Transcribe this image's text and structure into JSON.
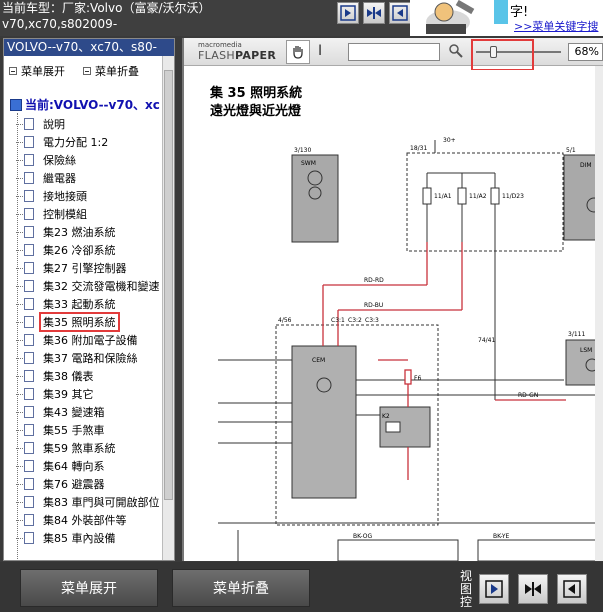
{
  "header": {
    "car_title": "当前车型：厂家:Volvo（富豪/沃尔沃）",
    "car_model": "v70,xc70,s802009-"
  },
  "ad": {
    "text": "字!",
    "link": ">>菜单关键字搜"
  },
  "sidebar": {
    "head": "VOLVO--v70、xc70、s80-",
    "expand_label": "菜单展开",
    "collapse_label": "菜单折叠",
    "root_label": "当前:VOLVO--v70、xc",
    "items": [
      {
        "label": "說明"
      },
      {
        "label": "電力分配 1:2"
      },
      {
        "label": "保險絲"
      },
      {
        "label": "繼電器"
      },
      {
        "label": "接地接頭"
      },
      {
        "label": "控制模組"
      },
      {
        "label": "集23 燃油系統"
      },
      {
        "label": "集26 冷卻系統"
      },
      {
        "label": "集27 引擎控制器"
      },
      {
        "label": "集32 交流發電機和變速"
      },
      {
        "label": "集33 起動系統"
      },
      {
        "label": "集35 照明系統",
        "selected": true
      },
      {
        "label": "集36 附加電子設備"
      },
      {
        "label": "集37 電路和保險絲"
      },
      {
        "label": "集38 儀表"
      },
      {
        "label": "集39 其它"
      },
      {
        "label": "集43 變速箱"
      },
      {
        "label": "集55 手煞車"
      },
      {
        "label": "集59 煞車系統"
      },
      {
        "label": "集64 轉向系"
      },
      {
        "label": "集76 避震器"
      },
      {
        "label": "集83 車門與可開啟部位"
      },
      {
        "label": "集84 外裝部件等"
      },
      {
        "label": "集85 車內設備"
      }
    ]
  },
  "viewer": {
    "logo_small": "macromedia",
    "logo_big_a": "FLASH",
    "logo_big_b": "PAPER",
    "search_value": "",
    "zoom": "68%",
    "zoom_level": 0.18,
    "doc_title": "集 35 照明系統",
    "doc_subtitle": "遠光燈與近光燈"
  },
  "diagram_labels": {
    "top_node": "30+",
    "sw_ref": "3/130",
    "sw_name": "SWM",
    "fuse_box_ref": "18/31",
    "fuse1": "11/A1",
    "fuse2": "11/A2",
    "fuse3": "11/D23",
    "dim_ref": "5/1",
    "dim_name": "DIM",
    "cem_ref": "4/56",
    "cem_name": "CEM",
    "relay": "K2",
    "relay_ref": "74/41",
    "fuse_f": "F6",
    "light_ref": "3/111",
    "light_name": "LSM",
    "con1": "C3:1",
    "con2": "C3:2",
    "con3": "C3:3",
    "wire1": "RD-RD",
    "wire2": "RD-BU",
    "wire3": "RD-GN",
    "bottom1": "BK-OG",
    "bottom2": "BK-YE"
  },
  "bottombar": {
    "expand_label": "菜单展开",
    "collapse_label": "菜单折叠",
    "view_label": "视图控"
  },
  "colors": {
    "accent_red": "#e23b3b",
    "sidebar_head": "#2e4a8a",
    "wire_red": "#c8323c",
    "component_gray": "#b0b0b0"
  }
}
